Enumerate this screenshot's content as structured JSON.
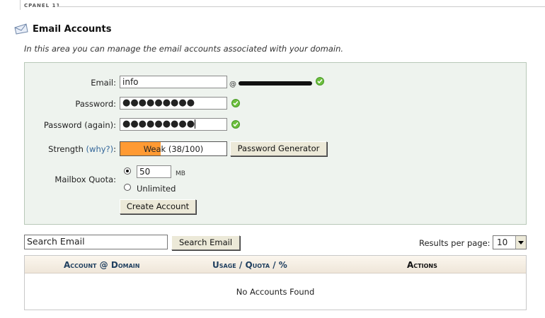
{
  "app": {
    "brand": "CPANEL 11"
  },
  "page": {
    "title": "Email Accounts",
    "description": "In this area you can manage the email accounts associated with your domain."
  },
  "form": {
    "email_label": "Email:",
    "email_value": "info",
    "at_sign": "@",
    "password_label": "Password:",
    "password_value": "●●●●●●●●●",
    "password_again_label": "Password (again):",
    "password_again_value": "●●●●●●●●●",
    "strength_label": "Strength",
    "strength_why": "(why?)",
    "strength_colon": ":",
    "strength_text": "Weak (38/100)",
    "strength_value": 38,
    "strength_max": 100,
    "strength_color": "#ff9a33",
    "password_generator_label": "Password Generator",
    "mailbox_quota_label": "Mailbox Quota:",
    "quota_value": "50",
    "quota_unit": "MB",
    "quota_unlimited_label": "Unlimited",
    "quota_selected": "limited",
    "create_account_label": "Create Account"
  },
  "search": {
    "input_value": "Search Email",
    "button_label": "Search Email",
    "results_per_page_label": "Results per page:",
    "results_per_page_value": "10"
  },
  "table": {
    "headers": {
      "account_a": "Account",
      "account_at": "@",
      "account_b": "Domain",
      "usage_a": "Usage",
      "usage_sep1": "/",
      "usage_b": "Quota",
      "usage_sep2": "/",
      "usage_c": "%",
      "actions": "Actions"
    },
    "empty_message": "No Accounts Found"
  },
  "colors": {
    "form_bg": "#eef3ee",
    "header_text": "#1f3f5f",
    "valid_check": "#6cbf3c"
  },
  "icons": [
    "envelope-icon",
    "check-icon",
    "radio-selected-icon",
    "radio-unselected-icon",
    "chevron-down-icon"
  ]
}
